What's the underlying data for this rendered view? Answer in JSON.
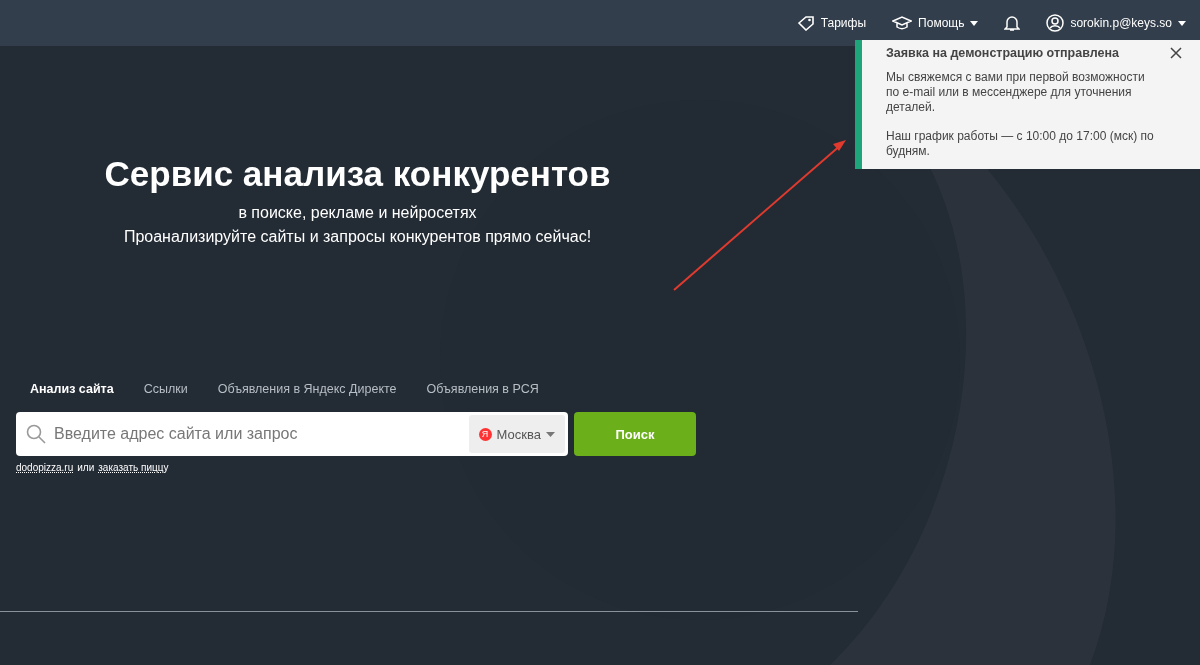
{
  "header": {
    "nav": [
      {
        "kind": "tag",
        "label": "Тарифы"
      },
      {
        "kind": "cap",
        "label": "Помощь",
        "dropdown": true
      },
      {
        "kind": "bell"
      },
      {
        "kind": "user",
        "label": "sorokin.p@keys.so",
        "dropdown": true
      }
    ]
  },
  "hero": {
    "title": "Сервис анализа конкурентов",
    "subtitle": "в поиске, рекламе и нейросетях",
    "tagline": "Проанализируйте сайты и запросы конкурентов прямо сейчас!"
  },
  "tabs": [
    {
      "label": "Анализ сайта",
      "selected": true
    },
    {
      "label": "Ссылки",
      "selected": false
    },
    {
      "label": "Объявления в Яндекс Директе",
      "selected": false
    },
    {
      "label": "Объявления в РСЯ",
      "selected": false
    }
  ],
  "search": {
    "placeholder": "Введите адрес сайта или запрос",
    "region_badge": "Я",
    "region": "Москва",
    "button": "Поиск"
  },
  "examples": [
    {
      "text": "dodopizza.ru"
    },
    {
      "text": "или",
      "plain": true
    },
    {
      "text": "заказать пиццу"
    }
  ],
  "toast": {
    "title": "Заявка на демонстрацию отправлена",
    "paragraphs": [
      "Мы свяжемся с вами при первой возможности по e-mail или в мессенджере для уточнения деталей.",
      "Наш график работы — с 10:00 до 17:00 (мск) по будням."
    ]
  }
}
